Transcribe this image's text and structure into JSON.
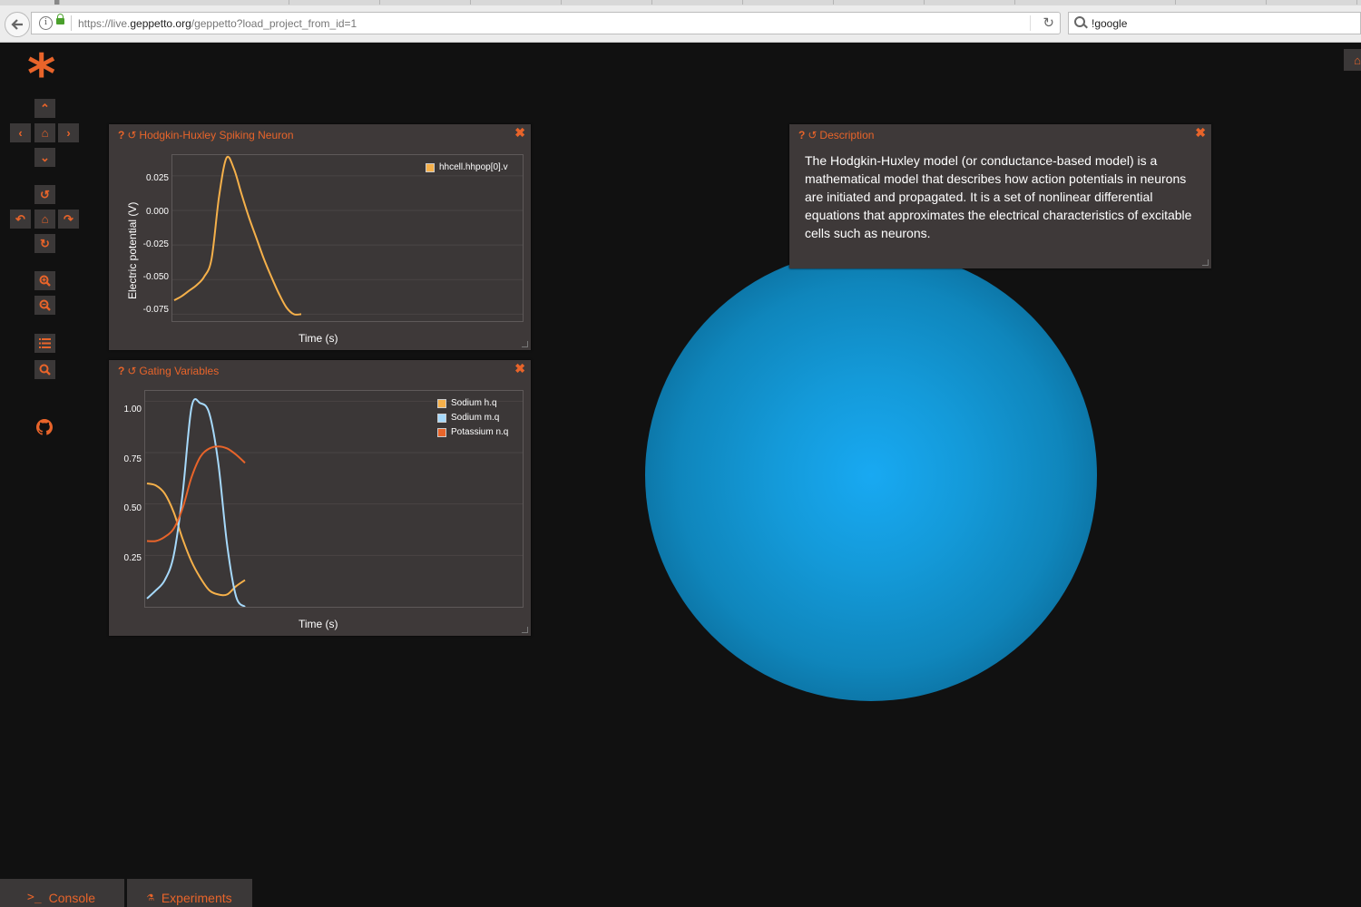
{
  "browser": {
    "url_prefix": "https://live.",
    "url_domain": "geppetto.org",
    "url_path": "/geppetto?load_project_from_id=1",
    "search_text": "!google"
  },
  "toolbar": {
    "logo_char": "*"
  },
  "widget_spiking": {
    "title": "Hodgkin-Huxley Spiking Neuron",
    "xlabel": "Time (s)",
    "ylabel": "Electric potential (V)",
    "yticks": [
      "0.025",
      "0.000",
      "-0.025",
      "-0.050",
      "-0.075"
    ],
    "legend": [
      {
        "label": "hhcell.hhpop[0].v",
        "color": "#f5b04a"
      }
    ]
  },
  "widget_gating": {
    "title": "Gating Variables",
    "xlabel": "Time (s)",
    "yticks": [
      "1.00",
      "0.75",
      "0.50",
      "0.25"
    ],
    "legend": [
      {
        "label": "Sodium h.q",
        "color": "#f5b04a"
      },
      {
        "label": "Sodium m.q",
        "color": "#a6d9fb"
      },
      {
        "label": "Potassium n.q",
        "color": "#e8642a"
      }
    ]
  },
  "widget_description": {
    "title": "Description",
    "text": "The Hodgkin-Huxley model (or conductance-based model) is a mathematical model that describes how action potentials in neurons are initiated and propagated. It is a set of nonlinear differential equations that approximates the electrical characteristics of excitable cells such as neurons."
  },
  "bottom_tabs": {
    "console": "Console",
    "experiments": "Experiments"
  },
  "colors": {
    "accent": "#e8642a",
    "panel": "#3e3939",
    "background": "#111111",
    "sphere": "#18a9f2"
  },
  "chart_data": [
    {
      "type": "line",
      "ylabel": "Electric potential (V)",
      "xlabel": "Time (s)",
      "ylim": [
        -0.08,
        0.04
      ],
      "series": [
        {
          "name": "hhcell.hhpop[0].v",
          "x": [
            0,
            1,
            2,
            3,
            4,
            5,
            6,
            7,
            8,
            9,
            10,
            11,
            12,
            13,
            14,
            15,
            16,
            17,
            18,
            19,
            20
          ],
          "values": [
            -0.065,
            -0.062,
            -0.058,
            -0.054,
            -0.048,
            -0.035,
            0.01,
            0.038,
            0.03,
            0.012,
            -0.005,
            -0.02,
            -0.035,
            -0.048,
            -0.06,
            -0.07,
            -0.075,
            -0.075,
            null,
            null,
            null
          ]
        }
      ]
    },
    {
      "type": "line",
      "xlabel": "Time (s)",
      "ylim": [
        0,
        1.05
      ],
      "series": [
        {
          "name": "Sodium h.q",
          "x": [
            0,
            2,
            4,
            6,
            8,
            10,
            12,
            14,
            16,
            18,
            20,
            22
          ],
          "values": [
            0.6,
            0.59,
            0.55,
            0.46,
            0.33,
            0.22,
            0.14,
            0.08,
            0.06,
            0.06,
            0.1,
            0.13
          ]
        },
        {
          "name": "Sodium m.q",
          "x": [
            0,
            2,
            4,
            6,
            8,
            10,
            12,
            14,
            16,
            18,
            20,
            22
          ],
          "values": [
            0.04,
            0.08,
            0.13,
            0.25,
            0.55,
            0.97,
            0.99,
            0.94,
            0.7,
            0.3,
            0.05,
            0.0
          ]
        },
        {
          "name": "Potassium n.q",
          "x": [
            0,
            2,
            4,
            6,
            8,
            10,
            12,
            14,
            16,
            18,
            20,
            22
          ],
          "values": [
            0.32,
            0.32,
            0.34,
            0.38,
            0.48,
            0.63,
            0.73,
            0.77,
            0.78,
            0.77,
            0.74,
            0.7
          ]
        }
      ]
    }
  ]
}
